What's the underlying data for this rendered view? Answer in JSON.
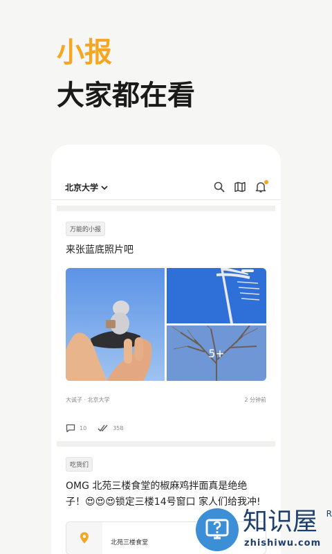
{
  "hero": {
    "subtitle": "小报",
    "title": "大家都在看"
  },
  "header": {
    "campus": "北京大学"
  },
  "posts": [
    {
      "tag": "万能的小报",
      "title": "来张蓝底照片吧",
      "more_photos": "5+",
      "author": "大诚子 · 北京大学",
      "time": "2 分钟前",
      "comments": "10",
      "likes": "358"
    },
    {
      "tag": "吃货们",
      "title": "OMG 北苑三楼食堂的椒麻鸡拌面真是绝绝子！😍😍😍锁定三楼14号窗口 家人们给我冲!",
      "location": "北苑三楼食堂"
    }
  ],
  "watermark": {
    "text": "知识屋",
    "url": "zhishiwu.com",
    "reg": "R"
  },
  "colors": {
    "accent": "#f5a623",
    "sky": "#3f7fe0"
  }
}
